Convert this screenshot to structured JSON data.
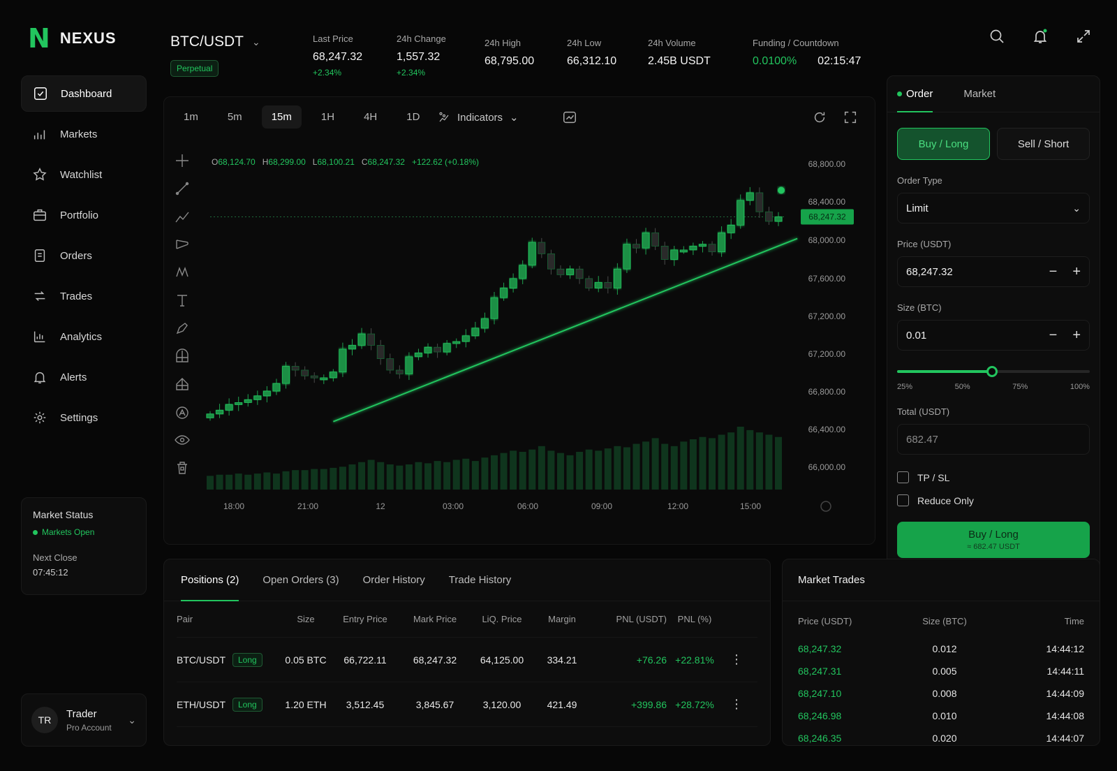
{
  "brand": {
    "name": "NEXUS",
    "mark": "N"
  },
  "nav": [
    {
      "label": "Dashboard",
      "icon": "dashboard-icon",
      "active": true
    },
    {
      "label": "Markets",
      "icon": "markets-icon"
    },
    {
      "label": "Watchlist",
      "icon": "star-icon"
    },
    {
      "label": "Portfolio",
      "icon": "portfolio-icon"
    },
    {
      "label": "Orders",
      "icon": "orders-icon"
    },
    {
      "label": "Trades",
      "icon": "trades-icon"
    },
    {
      "label": "Analytics",
      "icon": "analytics-icon"
    },
    {
      "label": "Alerts",
      "icon": "bell-icon"
    },
    {
      "label": "Settings",
      "icon": "gear-icon"
    }
  ],
  "market_status": {
    "title": "Market Status",
    "state": "Markets Open",
    "next_label": "Next Close",
    "next_value": "07:45:12"
  },
  "user": {
    "initials": "TR",
    "name": "Trader",
    "role": "Pro Account"
  },
  "header": {
    "pair": "BTC/USDT",
    "market_type": "Perpetual",
    "last_price": {
      "label": "Last Price",
      "value": "68,247.32",
      "sub": "+2.34%"
    },
    "change": {
      "label": "24h Change",
      "value": "1,557.32",
      "sub": "+2.34%"
    },
    "high": {
      "label": "24h High",
      "value": "68,795.00"
    },
    "low": {
      "label": "24h Low",
      "value": "66,312.10"
    },
    "volume": {
      "label": "24h Volume",
      "value": "2.45B USDT"
    },
    "funding": {
      "label": "Funding / Countdown",
      "rate": "0.0100%",
      "countdown": "02:15:47"
    }
  },
  "chart_toolbar": {
    "timeframes": [
      "1m",
      "5m",
      "15m",
      "1H",
      "4H",
      "1D"
    ],
    "active_timeframe": "15m",
    "indicators_label": "Indicators"
  },
  "ohlc": {
    "o_label": "O",
    "o": "68,124.70",
    "h_label": "H",
    "h": "68,299.00",
    "l_label": "L",
    "l": "68,100.21",
    "c_label": "C",
    "c": "68,247.32",
    "change": "+122.62 (+0.18%)"
  },
  "chart_data": {
    "type": "candlestick",
    "x_ticks": [
      "18:00",
      "21:00",
      "12",
      "03:00",
      "06:00",
      "09:00",
      "12:00",
      "15:00"
    ],
    "y_ticks": [
      "68,800.00",
      "68,400.00",
      "68,000.00",
      "67,600.00",
      "67,200.00",
      "67,200.00",
      "66,800.00",
      "66,400.00",
      "66,000.00"
    ],
    "y_tick_values": [
      68800,
      68400,
      68000,
      67600,
      67200,
      66800,
      66400,
      66000,
      65600
    ],
    "last_price_label": "68,247.32",
    "last_price": 68247.32,
    "closes": [
      66180,
      66220,
      66280,
      66300,
      66330,
      66370,
      66420,
      66500,
      66680,
      66640,
      66580,
      66560,
      66560,
      66620,
      66860,
      66900,
      67020,
      66900,
      66760,
      66640,
      66600,
      66780,
      66820,
      66880,
      66830,
      66920,
      66940,
      67000,
      67080,
      67180,
      67400,
      67500,
      67600,
      67740,
      67980,
      67860,
      67700,
      67640,
      67700,
      67600,
      67500,
      67560,
      67500,
      67700,
      67960,
      67920,
      68080,
      67940,
      67800,
      67900,
      67900,
      67940,
      67960,
      67880,
      68080,
      68160,
      68420,
      68500,
      68300,
      68200,
      68247
    ],
    "volumes": [
      12,
      13,
      13,
      14,
      13,
      14,
      15,
      14,
      16,
      17,
      17,
      18,
      18,
      19,
      20,
      22,
      24,
      26,
      24,
      22,
      21,
      22,
      24,
      23,
      25,
      24,
      26,
      27,
      25,
      28,
      30,
      32,
      34,
      33,
      35,
      38,
      34,
      32,
      30,
      33,
      35,
      34,
      36,
      38,
      37,
      40,
      42,
      45,
      40,
      38,
      42,
      44,
      46,
      45,
      48,
      50,
      55,
      52,
      50,
      48,
      46
    ],
    "trendline": {
      "from_index": 13,
      "from_value": 66100,
      "to_index": 62,
      "to_value": 68020
    }
  },
  "order_panel": {
    "tabs": [
      "Order",
      "Market"
    ],
    "buy_label": "Buy / Long",
    "sell_label": "Sell / Short",
    "order_type_label": "Order Type",
    "order_type": "Limit",
    "price_label": "Price (USDT)",
    "price": "68,247.32",
    "size_label": "Size (BTC)",
    "size": "0.01",
    "slider_percent": 50,
    "slider_marks": [
      "25%",
      "50%",
      "75%",
      "100%"
    ],
    "total_label": "Total (USDT)",
    "total": "682.47",
    "tpsl_label": "TP / SL",
    "reduce_label": "Reduce Only",
    "submit_label": "Buy / Long",
    "submit_sub": "≈ 682.47 USDT"
  },
  "positions": {
    "tabs": [
      "Positions (2)",
      "Open Orders (3)",
      "Order History",
      "Trade History"
    ],
    "columns": [
      "Pair",
      "Size",
      "Entry Price",
      "Mark Price",
      "LiQ. Price",
      "Margin",
      "PNL (USDT)",
      "PNL (%)"
    ],
    "rows": [
      {
        "pair": "BTC/USDT",
        "side": "Long",
        "size": "0.05 BTC",
        "entry": "66,722.11",
        "mark": "68,247.32",
        "liq": "64,125.00",
        "margin": "334.21",
        "pnl": "+76.26",
        "pnl_pct": "+22.81%"
      },
      {
        "pair": "ETH/USDT",
        "side": "Long",
        "size": "1.20 ETH",
        "entry": "3,512.45",
        "mark": "3,845.67",
        "liq": "3,120.00",
        "margin": "421.49",
        "pnl": "+399.86",
        "pnl_pct": "+28.72%"
      }
    ]
  },
  "market_trades": {
    "title": "Market Trades",
    "columns": [
      "Price (USDT)",
      "Size (BTC)",
      "Time"
    ],
    "rows": [
      {
        "price": "68,247.32",
        "size": "0.012",
        "time": "14:44:12"
      },
      {
        "price": "68,247.31",
        "size": "0.005",
        "time": "14:44:11"
      },
      {
        "price": "68,247.10",
        "size": "0.008",
        "time": "14:44:09"
      },
      {
        "price": "68,246.98",
        "size": "0.010",
        "time": "14:44:08"
      },
      {
        "price": "68,246.35",
        "size": "0.020",
        "time": "14:44:07"
      }
    ]
  },
  "colors": {
    "accent": "#22c55e",
    "background": "#070707",
    "panel": "#0d0d0d"
  }
}
